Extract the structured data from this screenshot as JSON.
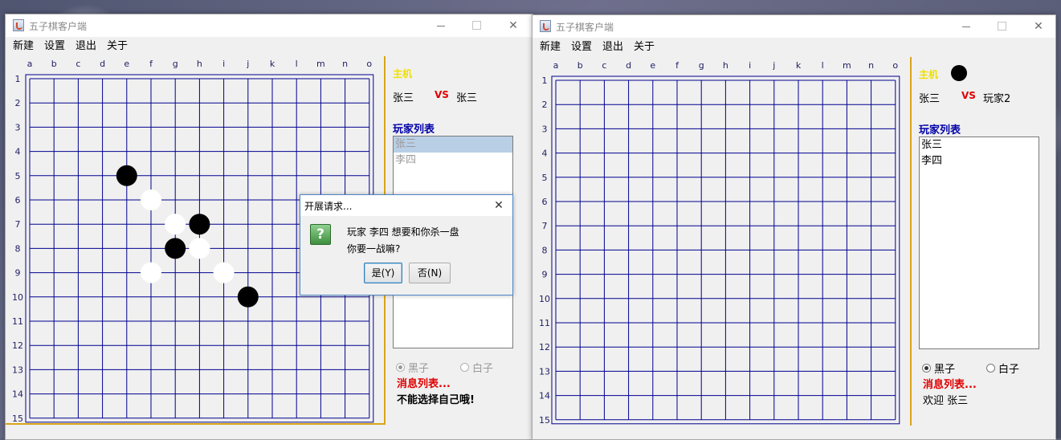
{
  "app": {
    "title": "五子棋客户端"
  },
  "menu": [
    "新建",
    "设置",
    "退出",
    "关于"
  ],
  "board": {
    "columns": [
      "a",
      "b",
      "c",
      "d",
      "e",
      "f",
      "g",
      "h",
      "i",
      "j",
      "k",
      "l",
      "m",
      "n",
      "o"
    ],
    "rows": [
      "1",
      "2",
      "3",
      "4",
      "5",
      "6",
      "7",
      "8",
      "9",
      "10",
      "11",
      "12",
      "13",
      "14",
      "15"
    ],
    "grid_color": "#000090",
    "label_color": "#1e1e64"
  },
  "left_window": {
    "host_label": "主机",
    "player1": "张三",
    "vs": "VS",
    "player2": "张三",
    "list_title": "玩家列表",
    "players": [
      "张三",
      "李四"
    ],
    "radio_black": "黑子",
    "radio_white": "白子",
    "msg_title": "消息列表...",
    "msg": "不能选择自己哦!",
    "stones": [
      {
        "col": 4,
        "row": 4,
        "color": "black"
      },
      {
        "col": 5,
        "row": 5,
        "color": "white"
      },
      {
        "col": 6,
        "row": 6,
        "color": "white"
      },
      {
        "col": 7,
        "row": 6,
        "color": "black"
      },
      {
        "col": 6,
        "row": 7,
        "color": "black"
      },
      {
        "col": 7,
        "row": 7,
        "color": "white"
      },
      {
        "col": 5,
        "row": 8,
        "color": "white"
      },
      {
        "col": 8,
        "row": 8,
        "color": "white"
      },
      {
        "col": 9,
        "row": 9,
        "color": "black"
      }
    ]
  },
  "right_window": {
    "host_label": "主机",
    "player1": "张三",
    "vs": "VS",
    "player2": "玩家2",
    "list_title": "玩家列表",
    "players": [
      "张三",
      "李四"
    ],
    "radio_black": "黑子",
    "radio_white": "白子",
    "msg_title": "消息列表...",
    "msg": "欢迎 张三"
  },
  "dialog": {
    "title": "开展请求...",
    "close": "✕",
    "line1": "玩家 李四 想要和你杀一盘",
    "line2": "你要一战嘛?",
    "yes": "是(Y)",
    "no": "否(N)"
  },
  "window_controls": {
    "minimize": "—",
    "close": "✕"
  }
}
